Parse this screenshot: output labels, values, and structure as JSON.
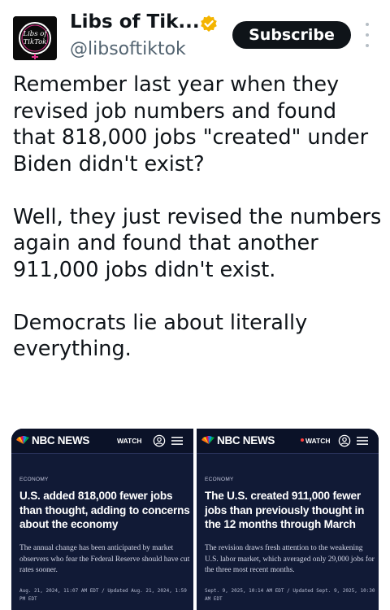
{
  "post": {
    "display_name": "Libs of Tik...",
    "handle": "@libsoftiktok",
    "subscribe_label": "Subscribe",
    "avatar_text": [
      "Libs of",
      "TikTok"
    ],
    "paragraphs": [
      "Remember last year when they revised job numbers and found that 818,000 jobs \"created\" under Biden didn't exist?",
      "Well, they just revised the numbers again and found that another 911,000 jobs didn't exist.",
      "Democrats lie about literally everything."
    ]
  },
  "media": {
    "left": {
      "brand": "NBC NEWS",
      "watch_label": "WATCH",
      "section": "ECONOMY",
      "headline": "U.S. added 818,000 fewer jobs than thought, adding to concerns about the economy",
      "dek": "The annual change has been anticipated by market observers who fear the Federal Reserve should have cut rates sooner.",
      "timestamp": "Aug. 21, 2024, 11:07 AM EDT / Updated Aug. 21, 2024, 1:59 PM EDT"
    },
    "right": {
      "brand": "NBC NEWS",
      "watch_label": "WATCH",
      "section": "ECONOMY",
      "headline": "The U.S. created 911,000 fewer jobs than previously thought in the 12 months through March",
      "dek": "The revision draws fresh attention to the weakening U.S. labor market, which averaged only 29,000 jobs for the three most recent months.",
      "timestamp": "Sept. 9, 2025, 10:14 AM EDT / Updated Sept. 9, 2025, 10:30 AM EDT"
    }
  },
  "colors": {
    "verified_badge": "#f4b400",
    "subscribe_bg": "#0f1419",
    "card_bg": "#111a36",
    "avatar_accent": "#e0338d"
  },
  "icons": {
    "verified": "verified-badge-icon",
    "more": "more-options-icon",
    "nbc_logo": "nbc-peacock-icon",
    "user": "user-account-icon",
    "menu": "hamburger-menu-icon"
  }
}
